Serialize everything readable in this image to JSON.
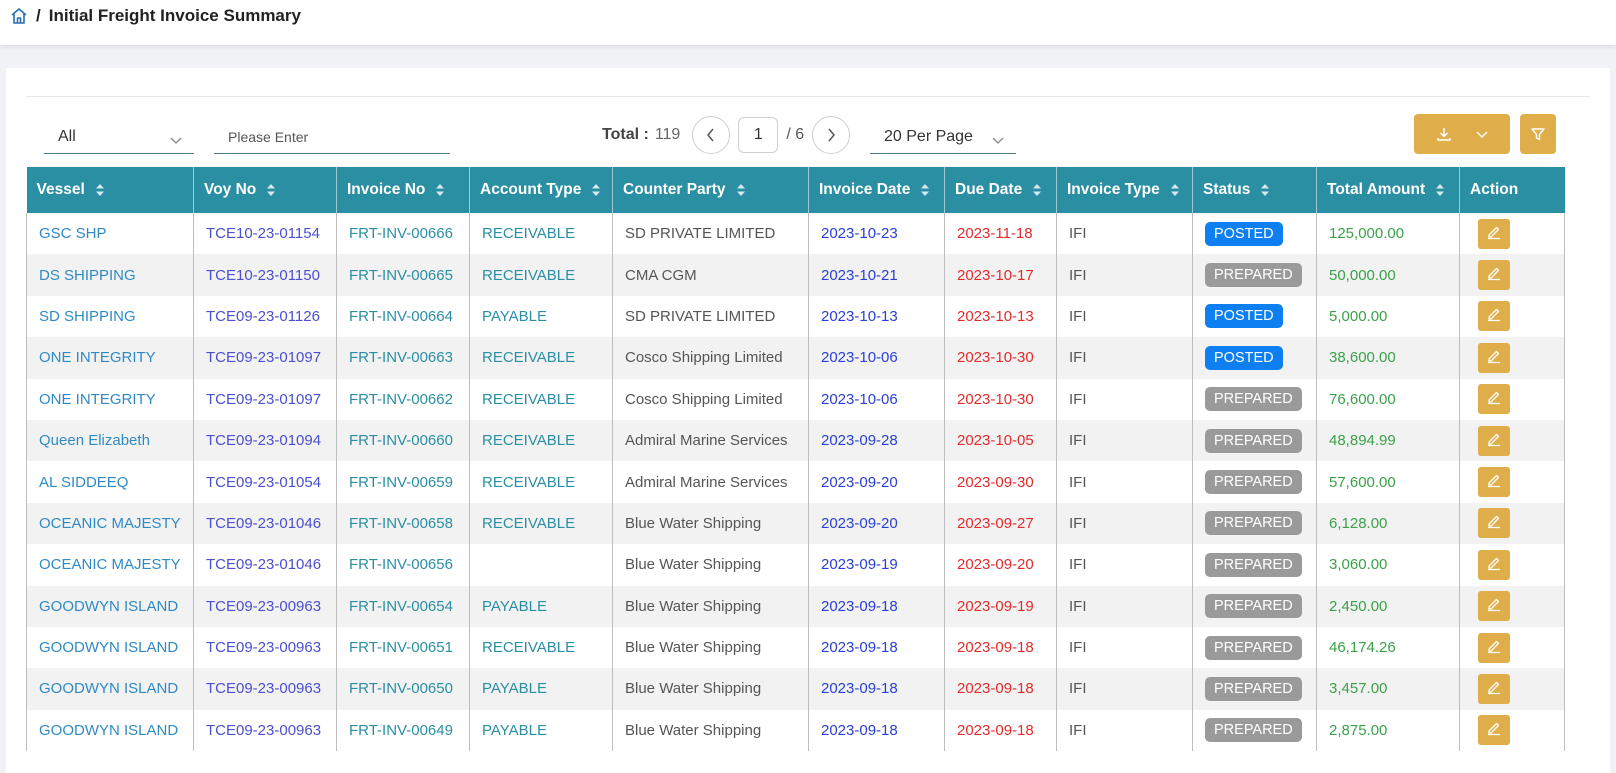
{
  "breadcrumb": {
    "separator": "/",
    "title": "Initial Freight Invoice Summary"
  },
  "filters": {
    "type_select": "All",
    "search_placeholder": "Please Enter"
  },
  "pagination": {
    "total_label": "Total :",
    "total": "119",
    "current_page": "1",
    "of_pages": "/ 6",
    "per_page": "20 Per Page"
  },
  "table": {
    "columns": [
      "Vessel",
      "Voy No",
      "Invoice No",
      "Account Type",
      "Counter Party",
      "Invoice Date",
      "Due Date",
      "Invoice Type",
      "Status",
      "Total Amount",
      "Action"
    ],
    "rows": [
      {
        "vessel": "GSC SHP",
        "voy": "TCE10-23-01154",
        "inv": "FRT-INV-00666",
        "acct": "RECEIVABLE",
        "cp": "SD PRIVATE LIMITED",
        "date": "2023-10-23",
        "due": "2023-11-18",
        "type": "IFI",
        "status": "POSTED",
        "amt": "125,000.00"
      },
      {
        "vessel": "DS SHIPPING",
        "voy": "TCE10-23-01150",
        "inv": "FRT-INV-00665",
        "acct": "RECEIVABLE",
        "cp": "CMA CGM",
        "date": "2023-10-21",
        "due": "2023-10-17",
        "type": "IFI",
        "status": "PREPARED",
        "amt": "50,000.00"
      },
      {
        "vessel": "SD SHIPPING",
        "voy": "TCE09-23-01126",
        "inv": "FRT-INV-00664",
        "acct": "PAYABLE",
        "cp": "SD PRIVATE LIMITED",
        "date": "2023-10-13",
        "due": "2023-10-13",
        "type": "IFI",
        "status": "POSTED",
        "amt": "5,000.00"
      },
      {
        "vessel": "ONE INTEGRITY",
        "voy": "TCE09-23-01097",
        "inv": "FRT-INV-00663",
        "acct": "RECEIVABLE",
        "cp": "Cosco Shipping Limited",
        "date": "2023-10-06",
        "due": "2023-10-30",
        "type": "IFI",
        "status": "POSTED",
        "amt": "38,600.00"
      },
      {
        "vessel": "ONE INTEGRITY",
        "voy": "TCE09-23-01097",
        "inv": "FRT-INV-00662",
        "acct": "RECEIVABLE",
        "cp": "Cosco Shipping Limited",
        "date": "2023-10-06",
        "due": "2023-10-30",
        "type": "IFI",
        "status": "PREPARED",
        "amt": "76,600.00"
      },
      {
        "vessel": "Queen Elizabeth",
        "voy": "TCE09-23-01094",
        "inv": "FRT-INV-00660",
        "acct": "RECEIVABLE",
        "cp": "Admiral Marine Services",
        "date": "2023-09-28",
        "due": "2023-10-05",
        "type": "IFI",
        "status": "PREPARED",
        "amt": "48,894.99"
      },
      {
        "vessel": "AL SIDDEEQ",
        "voy": "TCE09-23-01054",
        "inv": "FRT-INV-00659",
        "acct": "RECEIVABLE",
        "cp": "Admiral Marine Services",
        "date": "2023-09-20",
        "due": "2023-09-30",
        "type": "IFI",
        "status": "PREPARED",
        "amt": "57,600.00"
      },
      {
        "vessel": "OCEANIC MAJESTY",
        "voy": "TCE09-23-01046",
        "inv": "FRT-INV-00658",
        "acct": "RECEIVABLE",
        "cp": "Blue Water Shipping",
        "date": "2023-09-20",
        "due": "2023-09-27",
        "type": "IFI",
        "status": "PREPARED",
        "amt": "6,128.00"
      },
      {
        "vessel": "OCEANIC MAJESTY",
        "voy": "TCE09-23-01046",
        "inv": "FRT-INV-00656",
        "acct": "",
        "cp": "Blue Water Shipping",
        "date": "2023-09-19",
        "due": "2023-09-20",
        "type": "IFI",
        "status": "PREPARED",
        "amt": "3,060.00"
      },
      {
        "vessel": "GOODWYN ISLAND",
        "voy": "TCE09-23-00963",
        "inv": "FRT-INV-00654",
        "acct": "PAYABLE",
        "cp": "Blue Water Shipping",
        "date": "2023-09-18",
        "due": "2023-09-19",
        "type": "IFI",
        "status": "PREPARED",
        "amt": "2,450.00"
      },
      {
        "vessel": "GOODWYN ISLAND",
        "voy": "TCE09-23-00963",
        "inv": "FRT-INV-00651",
        "acct": "RECEIVABLE",
        "cp": "Blue Water Shipping",
        "date": "2023-09-18",
        "due": "2023-09-18",
        "type": "IFI",
        "status": "PREPARED",
        "amt": "46,174.26"
      },
      {
        "vessel": "GOODWYN ISLAND",
        "voy": "TCE09-23-00963",
        "inv": "FRT-INV-00650",
        "acct": "PAYABLE",
        "cp": "Blue Water Shipping",
        "date": "2023-09-18",
        "due": "2023-09-18",
        "type": "IFI",
        "status": "PREPARED",
        "amt": "3,457.00"
      },
      {
        "vessel": "GOODWYN ISLAND",
        "voy": "TCE09-23-00963",
        "inv": "FRT-INV-00649",
        "acct": "PAYABLE",
        "cp": "Blue Water Shipping",
        "date": "2023-09-18",
        "due": "2023-09-18",
        "type": "IFI",
        "status": "PREPARED",
        "amt": "2,875.00"
      }
    ]
  },
  "icons": {
    "home": "home-icon",
    "download": "download-icon",
    "filter": "funnel-icon",
    "edit": "edit-icon",
    "sort": "sort-icon"
  },
  "colors": {
    "header": "#2a8fa3",
    "accent": "#dfae4b",
    "posted": "#0d7ff0",
    "prepared": "#9a9a9a"
  }
}
